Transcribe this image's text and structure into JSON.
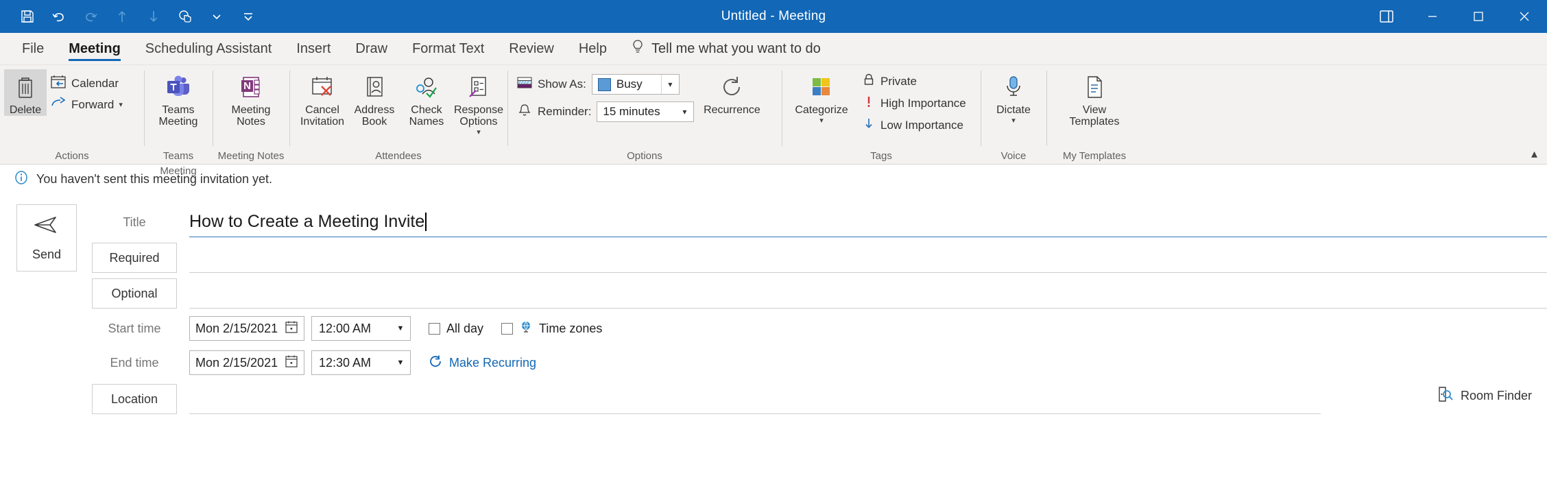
{
  "window": {
    "title": "Untitled  -  Meeting",
    "quick_access": [
      {
        "name": "save-icon",
        "label": "Save"
      },
      {
        "name": "undo-icon",
        "label": "Undo"
      },
      {
        "name": "redo-icon",
        "label": "Redo"
      },
      {
        "name": "up-arrow-icon",
        "label": "Previous Item"
      },
      {
        "name": "down-arrow-icon",
        "label": "Next Item"
      },
      {
        "name": "touch-mode-icon",
        "label": "Touch/Mouse Mode"
      },
      {
        "name": "chevron-down-icon",
        "label": "Touch Mode Options"
      },
      {
        "name": "customize-qat-icon",
        "label": "Customize Quick Access Toolbar"
      }
    ],
    "controls": {
      "ribbon_display": "Ribbon Display Options",
      "minimize": "Minimize",
      "restore": "Restore Down",
      "close": "Close"
    }
  },
  "tabs": [
    {
      "label": "File",
      "active": false
    },
    {
      "label": "Meeting",
      "active": true
    },
    {
      "label": "Scheduling Assistant",
      "active": false
    },
    {
      "label": "Insert",
      "active": false
    },
    {
      "label": "Draw",
      "active": false
    },
    {
      "label": "Format Text",
      "active": false
    },
    {
      "label": "Review",
      "active": false
    },
    {
      "label": "Help",
      "active": false
    }
  ],
  "tell_me": "Tell me what you want to do",
  "ribbon": {
    "groups": [
      {
        "label": "Actions"
      },
      {
        "label": "Teams Meeting"
      },
      {
        "label": "Meeting Notes"
      },
      {
        "label": "Attendees"
      },
      {
        "label": "Options"
      },
      {
        "label": "Tags"
      },
      {
        "label": "Voice"
      },
      {
        "label": "My Templates"
      }
    ],
    "delete": "Delete",
    "calendar": "Calendar",
    "forward": "Forward",
    "teams_meeting_l1": "Teams",
    "teams_meeting_l2": "Meeting",
    "meeting_notes_l1": "Meeting",
    "meeting_notes_l2": "Notes",
    "cancel_invitation_l1": "Cancel",
    "cancel_invitation_l2": "Invitation",
    "address_book_l1": "Address",
    "address_book_l2": "Book",
    "check_names_l1": "Check",
    "check_names_l2": "Names",
    "response_options_l1": "Response",
    "response_options_l2": "Options",
    "show_as_label": "Show As:",
    "show_as_value": "Busy",
    "reminder_label": "Reminder:",
    "reminder_value": "15 minutes",
    "recurrence": "Recurrence",
    "categorize": "Categorize",
    "private": "Private",
    "high_importance": "High Importance",
    "low_importance": "Low Importance",
    "dictate": "Dictate",
    "view_templates_l1": "View",
    "view_templates_l2": "Templates",
    "collapse_ribbon": "Collapse the Ribbon"
  },
  "infobar": {
    "message": "You haven't sent this meeting invitation yet."
  },
  "form": {
    "send_label": "Send",
    "title_label": "Title",
    "title_value": "How to Create a Meeting Invite",
    "required_label": "Required",
    "optional_label": "Optional",
    "start_time_label": "Start time",
    "end_time_label": "End time",
    "start_date": "Mon 2/15/2021",
    "start_time": "12:00 AM",
    "end_date": "Mon 2/15/2021",
    "end_time": "12:30 AM",
    "all_day_label": "All day",
    "time_zones_label": "Time zones",
    "make_recurring_label": "Make Recurring",
    "location_label": "Location",
    "room_finder_label": "Room Finder"
  },
  "colors": {
    "titlebar": "#1267b6",
    "ribbon_bg": "#f3f2f1",
    "accent": "#1267b6",
    "link": "#1267b6",
    "busy": "#5b9bd5",
    "high_importance": "#d13438",
    "low_importance": "#2f77b8"
  }
}
